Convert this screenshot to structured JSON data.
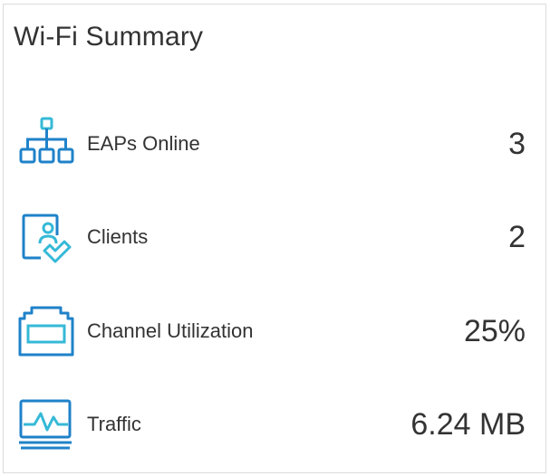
{
  "card": {
    "title": "Wi-Fi Summary"
  },
  "colors": {
    "icon_dark": "#1f82c9",
    "icon_light": "#35b9d7"
  },
  "metrics": [
    {
      "label": "EAPs Online",
      "value": "3",
      "icon": "network-topology-icon"
    },
    {
      "label": "Clients",
      "value": "2",
      "icon": "client-device-icon"
    },
    {
      "label": "Channel Utilization",
      "value": "25%",
      "icon": "channel-utilization-icon"
    },
    {
      "label": "Traffic",
      "value": "6.24 MB",
      "icon": "traffic-monitor-icon"
    }
  ]
}
